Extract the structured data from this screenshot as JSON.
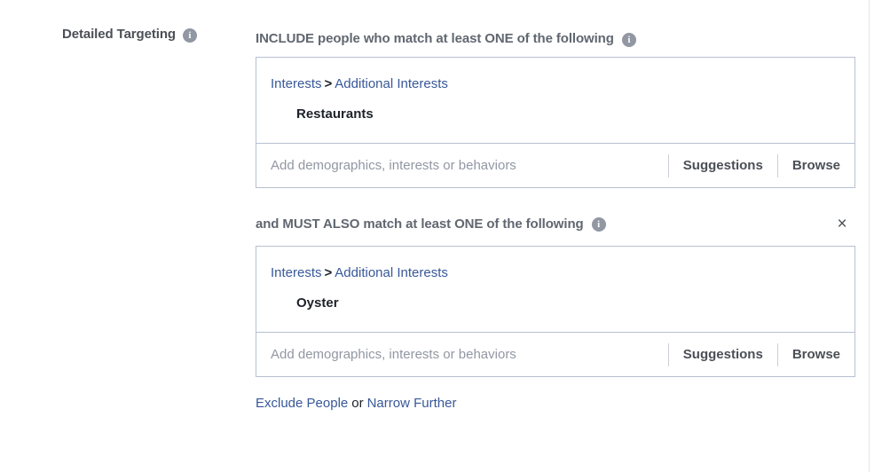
{
  "field": {
    "label": "Detailed Targeting",
    "info_icon": "info-icon"
  },
  "include_section": {
    "header": "INCLUDE people who match at least ONE of the following",
    "info_icon": "info-icon",
    "box": {
      "breadcrumb": {
        "root": "Interests",
        "separator": ">",
        "child": "Additional Interests"
      },
      "tags": [
        {
          "label": "Restaurants"
        }
      ],
      "input": {
        "placeholder": "Add demographics, interests or behaviors",
        "value": "",
        "suggestions_label": "Suggestions",
        "browse_label": "Browse"
      }
    }
  },
  "narrow_section": {
    "header": "and MUST ALSO match at least ONE of the following",
    "info_icon": "info-icon",
    "close_icon": "×",
    "box": {
      "breadcrumb": {
        "root": "Interests",
        "separator": ">",
        "child": "Additional Interests"
      },
      "tags": [
        {
          "label": "Oyster"
        }
      ],
      "input": {
        "placeholder": "Add demographics, interests or behaviors",
        "value": "",
        "suggestions_label": "Suggestions",
        "browse_label": "Browse"
      }
    }
  },
  "footer": {
    "exclude_label": "Exclude People",
    "conjunction": "or",
    "narrow_label": "Narrow Further"
  },
  "colors": {
    "link_blue": "#385898",
    "label_gray": "#4b4f56",
    "header_gray": "#606770",
    "placeholder_gray": "#9197a3",
    "box_border": "#b7c0d0",
    "tag_text": "#1d2129"
  },
  "icon_label": "i"
}
